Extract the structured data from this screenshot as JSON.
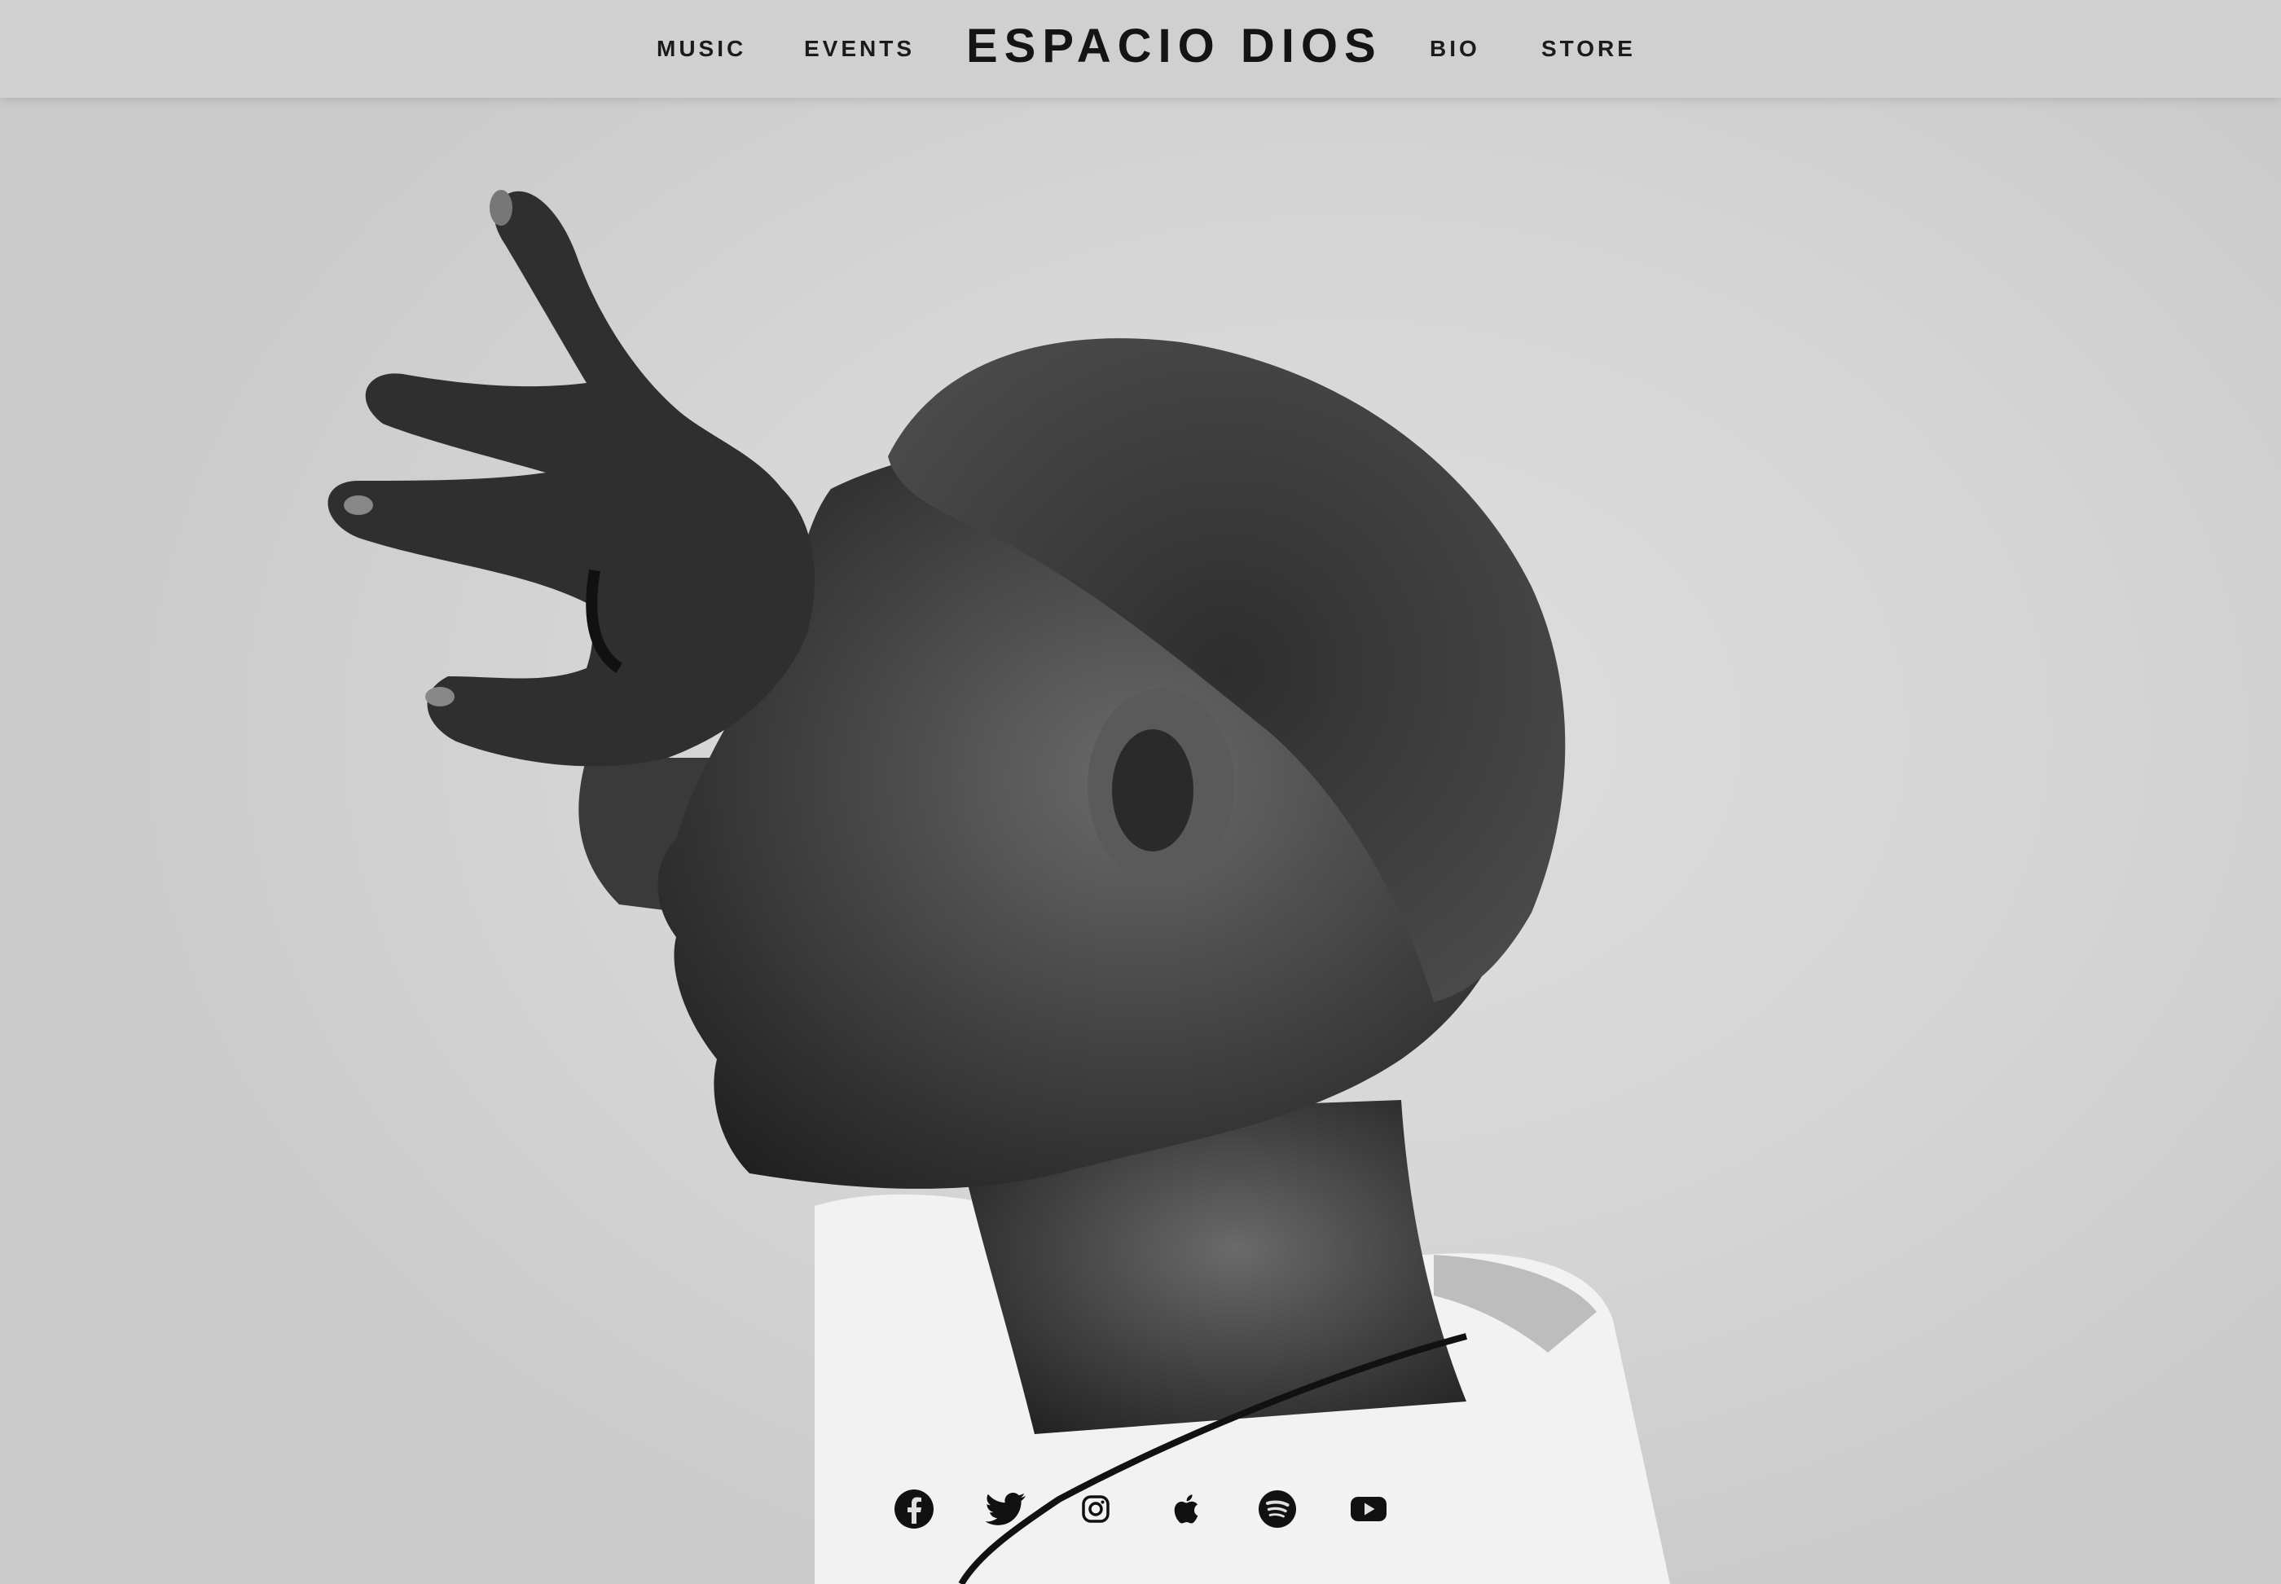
{
  "nav": {
    "left_items": [
      "MUSIC",
      "EVENTS"
    ],
    "brand": "ESPACIO DIOS",
    "right_items": [
      "BIO",
      "STORE"
    ]
  },
  "hero": {
    "image": "black-and-white portrait, person in profile with hand to forehead"
  },
  "social": [
    {
      "name": "facebook-icon"
    },
    {
      "name": "twitter-icon"
    },
    {
      "name": "instagram-icon"
    },
    {
      "name": "apple-music-icon"
    },
    {
      "name": "spotify-icon"
    },
    {
      "name": "youtube-icon"
    }
  ],
  "colors": {
    "nav_background": "#d0d0d0",
    "nav_text": "#1b1b1b",
    "photo_background": "#d5d5d5",
    "icon": "#111111"
  }
}
